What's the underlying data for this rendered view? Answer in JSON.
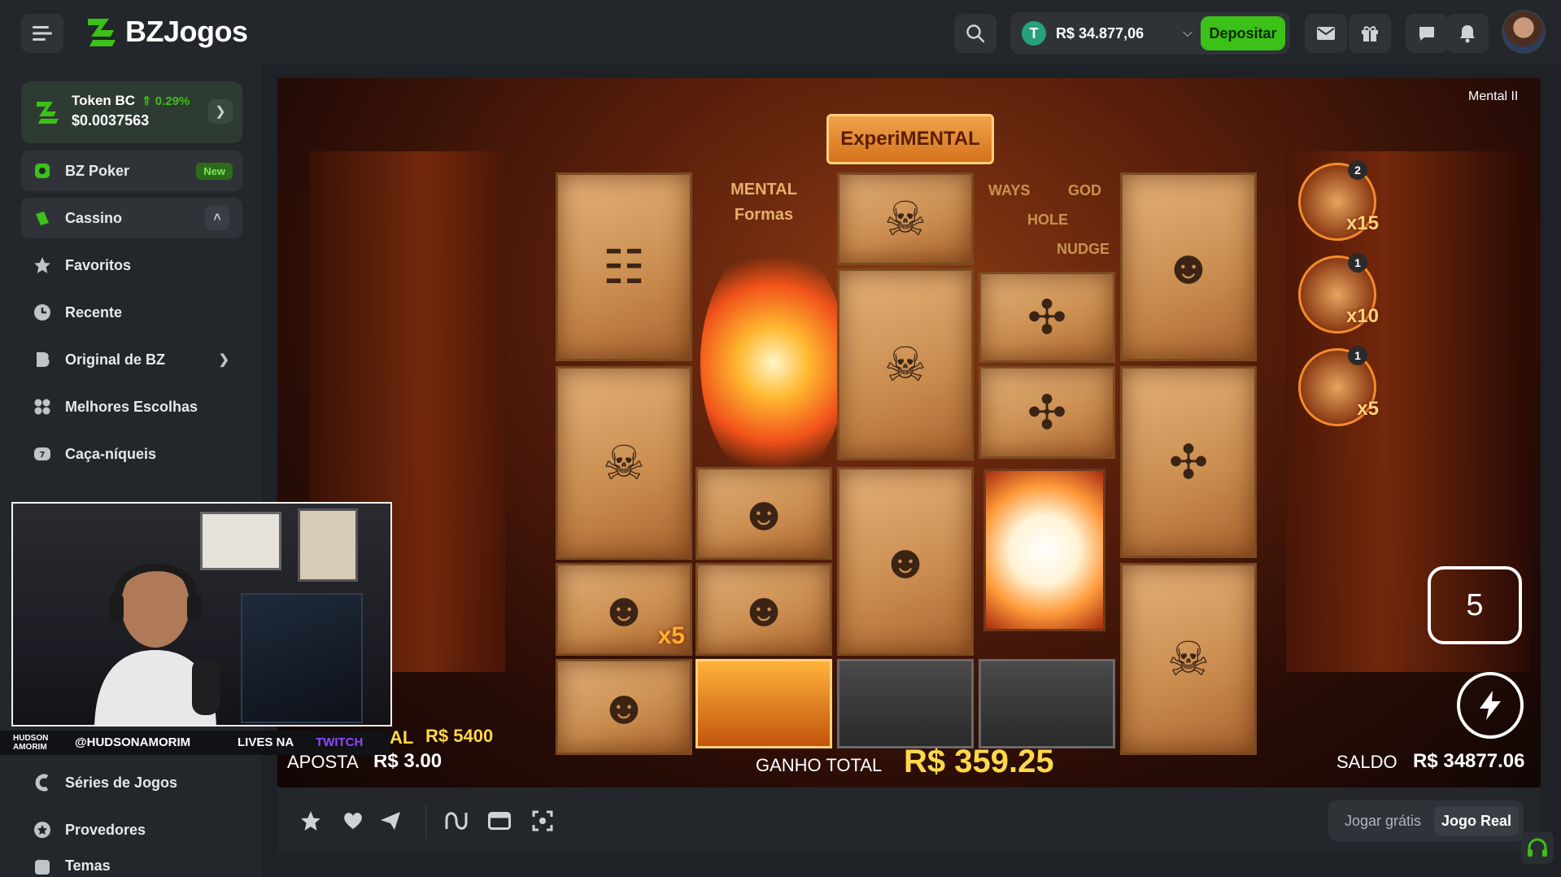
{
  "header": {
    "logo_text": "BZJogos",
    "balance": "R$ 34.877,06",
    "coin_symbol": "T",
    "deposit_label": "Depositar"
  },
  "sidebar": {
    "token": {
      "name": "Token BC",
      "change": "⇑ 0.29%",
      "price": "$0.0037563"
    },
    "items": [
      {
        "label": "BZ Poker",
        "badge": "New"
      },
      {
        "label": "Cassino"
      },
      {
        "label": "Favoritos"
      },
      {
        "label": "Recente"
      },
      {
        "label": "Original de BZ"
      },
      {
        "label": "Melhores Escolhas"
      },
      {
        "label": "Caça-níqueis"
      },
      {
        "label": "Séries de Jogos"
      },
      {
        "label": "Provedores"
      },
      {
        "label": "Temas"
      }
    ]
  },
  "stream": {
    "handle_small": "HUDSON AMORIM",
    "instagram": "@HUDSONAMORIM",
    "lives": "LIVES NA",
    "platform": "TWITCH"
  },
  "game": {
    "name": "Mental II",
    "banner": "ExperiMENTAL",
    "max_win_partial": "AL",
    "max_win_value": "R$ 5400",
    "bet_label": "APOSTA",
    "bet_value": "R$ 3.00",
    "win_label": "GANHO TOTAL",
    "win_value": "R$ 359.25",
    "balance_label": "SALDO",
    "balance_value": "R$ 34877.06",
    "spins_left": "5",
    "multipliers": [
      {
        "value": "x15",
        "count": "2"
      },
      {
        "value": "x10",
        "count": "1"
      },
      {
        "value": "x5",
        "count": "1"
      }
    ],
    "tile_multiplier": "x5",
    "reel_labels": {
      "mental": "MENTAL",
      "formas": "Formas",
      "ways": "WAYS",
      "god": "GOD",
      "hole": "HOLE",
      "nudge": "NUDGE"
    }
  },
  "toolbar": {
    "mode_free": "Jogar grátis",
    "mode_real": "Jogo Real"
  },
  "colors": {
    "accent": "#3bc117",
    "win": "#ffd84a"
  }
}
